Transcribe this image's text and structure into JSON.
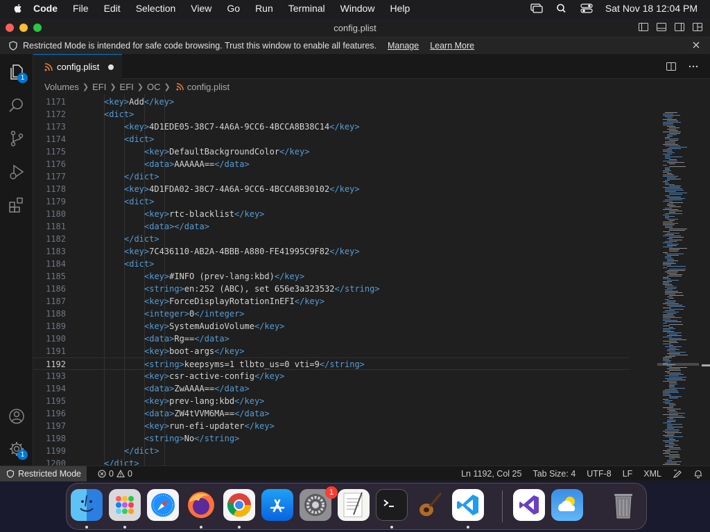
{
  "menubar": {
    "app_name": "Code",
    "items": [
      "File",
      "Edit",
      "Selection",
      "View",
      "Go",
      "Run",
      "Terminal",
      "Window",
      "Help"
    ],
    "clock": "Sat Nov 18  12:04 PM",
    "icons": [
      "screen-mirroring-icon",
      "spotlight-search-icon",
      "control-center-icon"
    ]
  },
  "window": {
    "title": "config.plist"
  },
  "banner": {
    "message": "Restricted Mode is intended for safe code browsing. Trust this window to enable all features.",
    "manage_link": "Manage",
    "learn_more_link": "Learn More"
  },
  "activitybar": {
    "explorer_badge": "1",
    "manage_badge": "1"
  },
  "tab": {
    "label": "config.plist"
  },
  "breadcrumb": [
    "Volumes",
    "EFI",
    "EFI",
    "OC",
    "config.plist"
  ],
  "code_lines": [
    {
      "n": "1171",
      "indent": 2,
      "tokens": [
        [
          "t",
          "<key>"
        ],
        [
          "tx",
          "Add"
        ],
        [
          "t",
          "</key>"
        ]
      ]
    },
    {
      "n": "1172",
      "indent": 2,
      "tokens": [
        [
          "t",
          "<dict>"
        ]
      ]
    },
    {
      "n": "1173",
      "indent": 3,
      "tokens": [
        [
          "t",
          "<key>"
        ],
        [
          "tx",
          "4D1EDE05-38C7-4A6A-9CC6-4BCCA8B38C14"
        ],
        [
          "t",
          "</key>"
        ]
      ]
    },
    {
      "n": "1174",
      "indent": 3,
      "tokens": [
        [
          "t",
          "<dict>"
        ]
      ]
    },
    {
      "n": "1175",
      "indent": 4,
      "tokens": [
        [
          "t",
          "<key>"
        ],
        [
          "tx",
          "DefaultBackgroundColor"
        ],
        [
          "t",
          "</key>"
        ]
      ]
    },
    {
      "n": "1176",
      "indent": 4,
      "tokens": [
        [
          "t",
          "<data>"
        ],
        [
          "tx",
          "AAAAAA=="
        ],
        [
          "t",
          "</data>"
        ]
      ]
    },
    {
      "n": "1177",
      "indent": 3,
      "tokens": [
        [
          "t",
          "</dict>"
        ]
      ]
    },
    {
      "n": "1178",
      "indent": 3,
      "tokens": [
        [
          "t",
          "<key>"
        ],
        [
          "tx",
          "4D1FDA02-38C7-4A6A-9CC6-4BCCA8B30102"
        ],
        [
          "t",
          "</key>"
        ]
      ]
    },
    {
      "n": "1179",
      "indent": 3,
      "tokens": [
        [
          "t",
          "<dict>"
        ]
      ]
    },
    {
      "n": "1180",
      "indent": 4,
      "tokens": [
        [
          "t",
          "<key>"
        ],
        [
          "tx",
          "rtc-blacklist"
        ],
        [
          "t",
          "</key>"
        ]
      ]
    },
    {
      "n": "1181",
      "indent": 4,
      "tokens": [
        [
          "t",
          "<data></data>"
        ]
      ]
    },
    {
      "n": "1182",
      "indent": 3,
      "tokens": [
        [
          "t",
          "</dict>"
        ]
      ]
    },
    {
      "n": "1183",
      "indent": 3,
      "tokens": [
        [
          "t",
          "<key>"
        ],
        [
          "tx",
          "7C436110-AB2A-4BBB-A880-FE41995C9F82"
        ],
        [
          "t",
          "</key>"
        ]
      ]
    },
    {
      "n": "1184",
      "indent": 3,
      "tokens": [
        [
          "t",
          "<dict>"
        ]
      ]
    },
    {
      "n": "1185",
      "indent": 4,
      "tokens": [
        [
          "t",
          "<key>"
        ],
        [
          "tx",
          "#INFO (prev-lang:kbd)"
        ],
        [
          "t",
          "</key>"
        ]
      ]
    },
    {
      "n": "1186",
      "indent": 4,
      "tokens": [
        [
          "t",
          "<string>"
        ],
        [
          "tx",
          "en:252 (ABC), set 656e3a323532"
        ],
        [
          "t",
          "</string>"
        ]
      ]
    },
    {
      "n": "1187",
      "indent": 4,
      "tokens": [
        [
          "t",
          "<key>"
        ],
        [
          "tx",
          "ForceDisplayRotationInEFI"
        ],
        [
          "t",
          "</key>"
        ]
      ]
    },
    {
      "n": "1188",
      "indent": 4,
      "tokens": [
        [
          "t",
          "<integer>"
        ],
        [
          "tx",
          "0"
        ],
        [
          "t",
          "</integer>"
        ]
      ]
    },
    {
      "n": "1189",
      "indent": 4,
      "tokens": [
        [
          "t",
          "<key>"
        ],
        [
          "tx",
          "SystemAudioVolume"
        ],
        [
          "t",
          "</key>"
        ]
      ]
    },
    {
      "n": "1190",
      "indent": 4,
      "tokens": [
        [
          "t",
          "<data>"
        ],
        [
          "tx",
          "Rg=="
        ],
        [
          "t",
          "</data>"
        ]
      ]
    },
    {
      "n": "1191",
      "indent": 4,
      "tokens": [
        [
          "t",
          "<key>"
        ],
        [
          "tx",
          "boot-args"
        ],
        [
          "t",
          "</key>"
        ]
      ]
    },
    {
      "n": "1192",
      "indent": 4,
      "current": true,
      "tokens": [
        [
          "t",
          "<string>"
        ],
        [
          "tx",
          "keepsyms=1 tlbto_us=0 vti=9"
        ],
        [
          "t",
          "</string>"
        ]
      ]
    },
    {
      "n": "1193",
      "indent": 4,
      "tokens": [
        [
          "t",
          "<key>"
        ],
        [
          "tx",
          "csr-active-config"
        ],
        [
          "t",
          "</key>"
        ]
      ]
    },
    {
      "n": "1194",
      "indent": 4,
      "tokens": [
        [
          "t",
          "<data>"
        ],
        [
          "tx",
          "ZwAAAA=="
        ],
        [
          "t",
          "</data>"
        ]
      ]
    },
    {
      "n": "1195",
      "indent": 4,
      "tokens": [
        [
          "t",
          "<key>"
        ],
        [
          "tx",
          "prev-lang:kbd"
        ],
        [
          "t",
          "</key>"
        ]
      ]
    },
    {
      "n": "1196",
      "indent": 4,
      "tokens": [
        [
          "t",
          "<data>"
        ],
        [
          "tx",
          "ZW4tVVM6MA=="
        ],
        [
          "t",
          "</data>"
        ]
      ]
    },
    {
      "n": "1197",
      "indent": 4,
      "tokens": [
        [
          "t",
          "<key>"
        ],
        [
          "tx",
          "run-efi-updater"
        ],
        [
          "t",
          "</key>"
        ]
      ]
    },
    {
      "n": "1198",
      "indent": 4,
      "tokens": [
        [
          "t",
          "<string>"
        ],
        [
          "tx",
          "No"
        ],
        [
          "t",
          "</string>"
        ]
      ]
    },
    {
      "n": "1199",
      "indent": 3,
      "tokens": [
        [
          "t",
          "</dict>"
        ]
      ]
    },
    {
      "n": "1200",
      "indent": 2,
      "tokens": [
        [
          "t",
          "</dict>"
        ]
      ]
    }
  ],
  "statusbar": {
    "restricted_mode": "Restricted Mode",
    "errors": "0",
    "warnings": "0",
    "cursor": "Ln 1192, Col 25",
    "tab_size": "Tab Size: 4",
    "encoding": "UTF-8",
    "eol": "LF",
    "language": "XML"
  },
  "dock": {
    "apps": [
      "finder",
      "launchpad",
      "safari",
      "firefox",
      "chrome",
      "app-store",
      "system-settings",
      "textedit",
      "terminal",
      "garageband",
      "vscode",
      "visual-studio",
      "weather",
      "trash"
    ],
    "system_settings_badge": "1"
  },
  "colors": {
    "tag": "#569cd6",
    "text": "#d4d4d4",
    "accent": "#0078d4"
  }
}
